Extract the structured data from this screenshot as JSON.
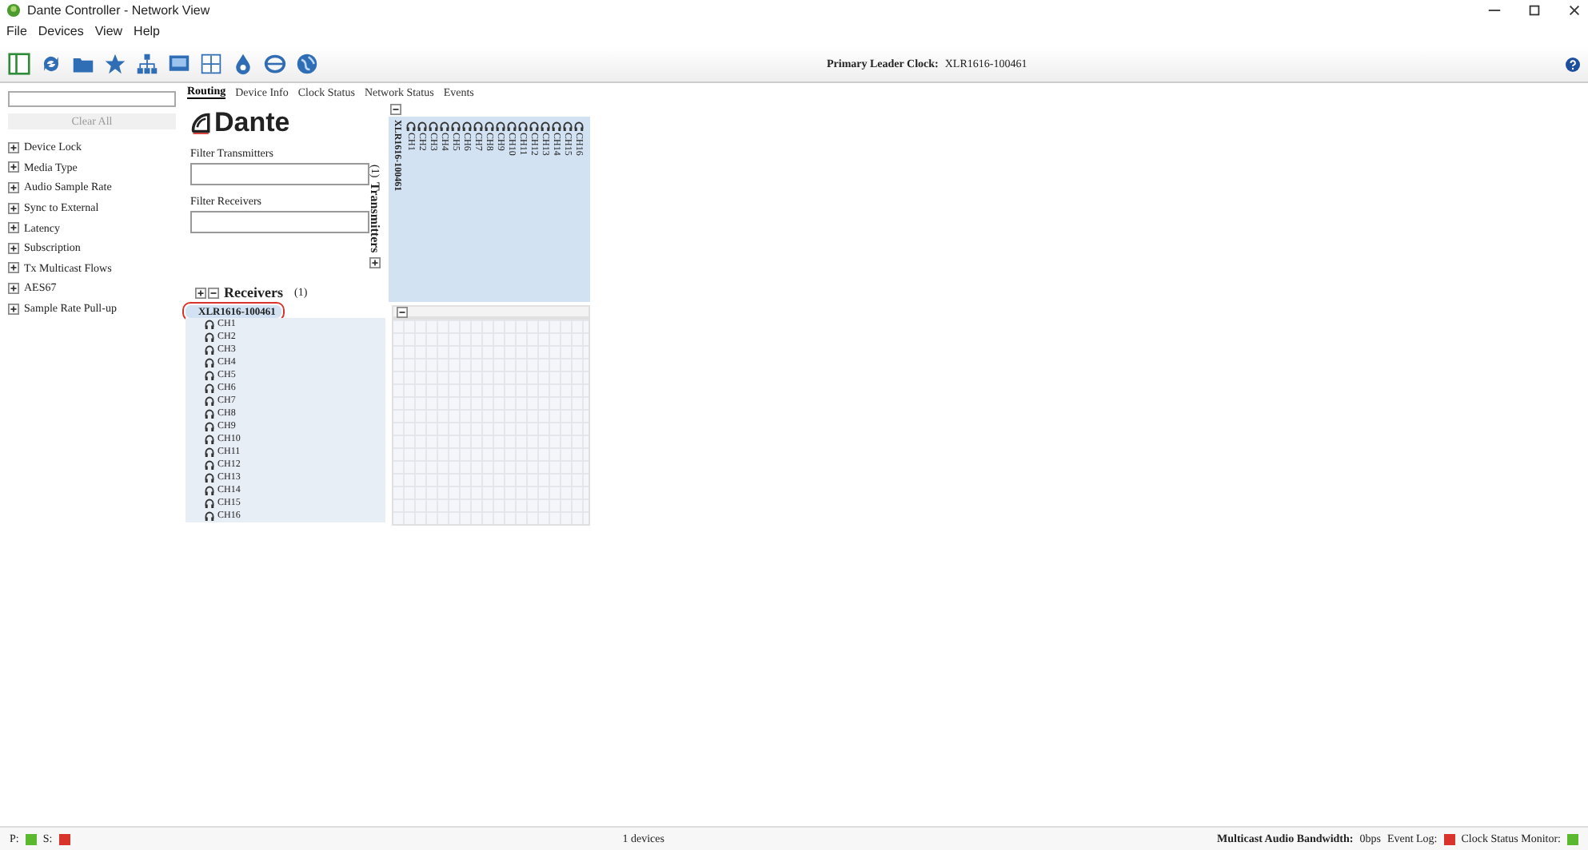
{
  "window": {
    "title": "Dante Controller - Network View"
  },
  "menu": [
    "File",
    "Devices",
    "View",
    "Help"
  ],
  "toolbar": {
    "leader_label": "Primary Leader Clock:",
    "leader_value": "XLR1616-100461"
  },
  "tabs": [
    {
      "label": "Routing",
      "selected": true
    },
    {
      "label": "Device Info",
      "selected": false
    },
    {
      "label": "Clock Status",
      "selected": false
    },
    {
      "label": "Network Status",
      "selected": false
    },
    {
      "label": "Events",
      "selected": false
    }
  ],
  "sidebar": {
    "clear_button": "Clear All",
    "filters": [
      {
        "label": "Device Lock",
        "expanded": false
      },
      {
        "label": "Media Type",
        "expanded": false
      },
      {
        "label": "Audio Sample Rate",
        "expanded": false
      },
      {
        "label": "Sync to External",
        "expanded": false
      },
      {
        "label": "Latency",
        "expanded": false
      },
      {
        "label": "Subscription",
        "expanded": false
      },
      {
        "label": "Tx Multicast Flows",
        "expanded": false
      },
      {
        "label": "AES67",
        "expanded": false
      },
      {
        "label": "Sample Rate Pull-up",
        "expanded": false
      }
    ]
  },
  "routing": {
    "logo": "Dante",
    "filter_transmitters": "Filter Transmitters",
    "filter_receivers": "Filter Receivers",
    "transmitters_label": "Transmitters",
    "transmitters_count": "(1)",
    "transmitter": {
      "name": "XLR1616-100461",
      "expanded": true,
      "channels": [
        "CH1",
        "CH2",
        "CH3",
        "CH4",
        "CH5",
        "CH6",
        "CH7",
        "CH8",
        "CH9",
        "CH10",
        "CH11",
        "CH12",
        "CH13",
        "CH14",
        "CH15",
        "CH16"
      ]
    },
    "receivers_label": "Receivers",
    "receivers_count": "(1)",
    "receiver": {
      "name": "XLR1616-100461",
      "expanded": true,
      "highlighted": true,
      "channels": [
        "CH1",
        "CH2",
        "CH3",
        "CH4",
        "CH5",
        "CH6",
        "CH7",
        "CH8",
        "CH9",
        "CH10",
        "CH11",
        "CH12",
        "CH13",
        "CH14",
        "CH15",
        "CH16"
      ]
    }
  },
  "status_bar": {
    "clock_indicators": [
      {
        "label": "P:",
        "color": "#5cb82e"
      },
      {
        "label": "S:",
        "color": "#d9342b"
      }
    ],
    "device_count": "1 devices",
    "bandwidth_label": "Multicast Audio Bandwidth:",
    "bandwidth_value": "0bps",
    "monitors": [
      {
        "label": "Event Log:",
        "color": "#d9342b"
      },
      {
        "label": "Clock Status Monitor:",
        "color": "#5cb82e"
      }
    ]
  }
}
